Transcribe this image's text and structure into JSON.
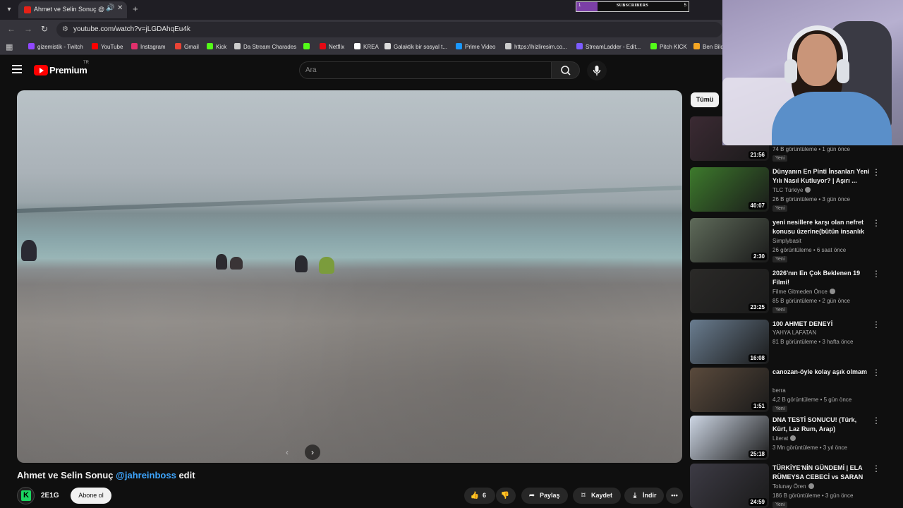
{
  "browser": {
    "tab_title": "Ahmet ve Selin Sonuç @jahreinboss edit - YouTube",
    "url": "youtube.com/watch?v=jLGDAhqEu4k",
    "bookmarks": [
      {
        "label": "gizemistik - Twitch",
        "color": "#9147ff"
      },
      {
        "label": "YouTube",
        "color": "#ff0000"
      },
      {
        "label": "Instagram",
        "color": "#e1306c"
      },
      {
        "label": "Gmail",
        "color": "#ea4335"
      },
      {
        "label": "Kick",
        "color": "#53fc18"
      },
      {
        "label": "Da Stream Charades",
        "color": "#cccccc"
      },
      {
        "label": "",
        "color": "#53fc18"
      },
      {
        "label": "Netflix",
        "color": "#e50914"
      },
      {
        "label": "KREA",
        "color": "#ffffff"
      },
      {
        "label": "Galaktik bir sosyal t...",
        "color": "#dddddd"
      },
      {
        "label": "Prime Video",
        "color": "#1a98ff"
      },
      {
        "label": "https://hizliresim.co...",
        "color": "#cccccc"
      },
      {
        "label": "StreamLadder - Edit...",
        "color": "#7c5cff"
      },
      {
        "label": "Pitch KICK",
        "color": "#53fc18"
      },
      {
        "label": "Ben Bild",
        "color": "#f5a623"
      }
    ]
  },
  "overlay": {
    "subs_label": "SUBSCRIBERS",
    "subs_min": "1",
    "subs_max": "5",
    "subs_progress": 0.19
  },
  "header": {
    "logo_text": "Premium",
    "country": "TR",
    "search_placeholder": "Ara"
  },
  "video": {
    "title": "Ahmet ve Selin Sonuç",
    "mention": "@jahreinboss",
    "title_suffix": "edit",
    "channel_name": "2E1G",
    "subscribe_label": "Abone ol",
    "likes": "6",
    "share_label": "Paylaş",
    "save_label": "Kaydet",
    "download_label": "İndir"
  },
  "sidebar": {
    "chip_all": "Tümü",
    "recommendations": [
      {
        "title": "",
        "channel": "",
        "meta": "74 B görüntüleme • 1 gün önce",
        "badge": "Yeni",
        "duration": "21:56",
        "thumb": "#3b2a33"
      },
      {
        "title": "Dünyanın En Pinti İnsanları Yeni Yılı Nasıl Kutluyor? | Aşırı ...",
        "channel": "TLC Türkiye",
        "verified": true,
        "meta": "26 B görüntüleme • 3 gün önce",
        "badge": "Yeni",
        "duration": "40:07",
        "thumb": "#3d7a2c"
      },
      {
        "title": "yeni nesillere karşı olan nefret konusu üzerine(bütün insanlık ...",
        "channel": "Simplybasit",
        "meta": "26 görüntüleme • 6 saat önce",
        "badge": "Yeni",
        "duration": "2:30",
        "thumb": "#5f6b5a"
      },
      {
        "title": "2026'nın En Çok Beklenen 19 Filmi!",
        "channel": "Filme Gitmeden Önce",
        "verified": true,
        "meta": "85 B görüntüleme • 2 gün önce",
        "badge": "Yeni",
        "duration": "23:25",
        "thumb": "#2b2a28"
      },
      {
        "title": "100 AHMET DENEYİ",
        "channel": "YAHYA LAFATAN",
        "meta": "81 B görüntüleme • 3 hafta önce",
        "badge": "",
        "duration": "16:08",
        "thumb": "#6a7d90"
      },
      {
        "title": "canozan-öyle kolay aşık olmam",
        "channel": "berra",
        "meta": "4,2 B görüntüleme • 5 gün önce",
        "badge": "Yeni",
        "duration": "1:51",
        "thumb": "#5a4a3c"
      },
      {
        "title": "DNA TESTİ SONUCU! (Türk, Kürt, Laz Rum, Arap)",
        "channel": "Literat",
        "verified": true,
        "meta": "3 Mn görüntüleme • 3 yıl önce",
        "badge": "",
        "duration": "25:18",
        "thumb": "#cdd6e4"
      },
      {
        "title": "TÜRKİYE'NİN GÜNDEMİ | ELA RÜMEYSA CEBECİ vs SARAN",
        "channel": "Tolunay Ören",
        "verified": true,
        "meta": "186 B görüntüleme • 3 gün önce",
        "badge": "Yeni",
        "duration": "24:59",
        "thumb": "#3d3b45"
      }
    ]
  }
}
